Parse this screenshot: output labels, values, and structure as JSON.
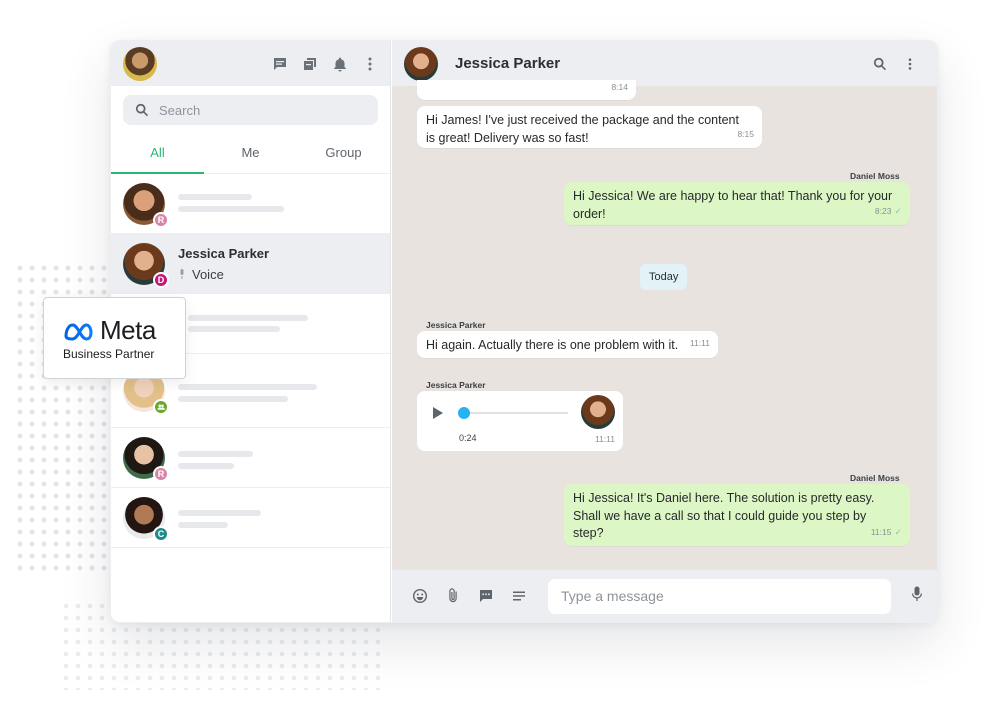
{
  "colors": {
    "accent": "#2bb673",
    "outgoing_bubble": "#dcf7c5",
    "chat_bg": "#e9e3df",
    "voice_progress": "#26b3ef"
  },
  "left_header": {
    "icons": [
      "chat-icon",
      "archive-icon",
      "bell-icon",
      "more-vert-icon"
    ]
  },
  "search": {
    "placeholder": "Search"
  },
  "tabs": [
    {
      "label": "All",
      "active": true
    },
    {
      "label": "Me",
      "active": false
    },
    {
      "label": "Group",
      "active": false
    }
  ],
  "chats": [
    {
      "badge": "R",
      "badge_color": "#d884a8"
    },
    {
      "name": "Jessica Parker",
      "preview": "Voice",
      "badge": "D",
      "badge_color": "#c2187a",
      "selected": true
    },
    {
      "badge": "",
      "badge_color": "#d884a8"
    },
    {
      "badge": "",
      "badge_color": "#6aaa2a"
    },
    {
      "badge": "R",
      "badge_color": "#d884a8"
    },
    {
      "badge": "C",
      "badge_color": "#1f8a8a"
    }
  ],
  "conversation": {
    "contact_name": "Jessica Parker",
    "messages": [
      {
        "time": "8:14"
      },
      {
        "text": "Hi James! I've just received the package and the content is great! Delivery was so fast!",
        "time": "8:15"
      },
      {
        "sender": "Daniel Moss",
        "text": "Hi Jessica! We are happy to hear that! Thank you for your order!",
        "time": "8:23"
      },
      {
        "divider": "Today"
      },
      {
        "sender": "Jessica Parker",
        "text": "Hi again. Actually there is one problem with it.",
        "time": "11:11"
      },
      {
        "sender": "Jessica Parker",
        "voice_duration": "0:24",
        "time": "11:11",
        "progress": 0
      },
      {
        "sender": "Daniel Moss",
        "text": "Hi Jessica! It's Daniel here. The solution is pretty easy. Shall we have a call so that I could guide you step by step?",
        "time": "11:15"
      }
    ]
  },
  "composer": {
    "placeholder": "Type a message"
  },
  "meta_badge": {
    "word": "Meta",
    "subtitle": "Business Partner"
  }
}
